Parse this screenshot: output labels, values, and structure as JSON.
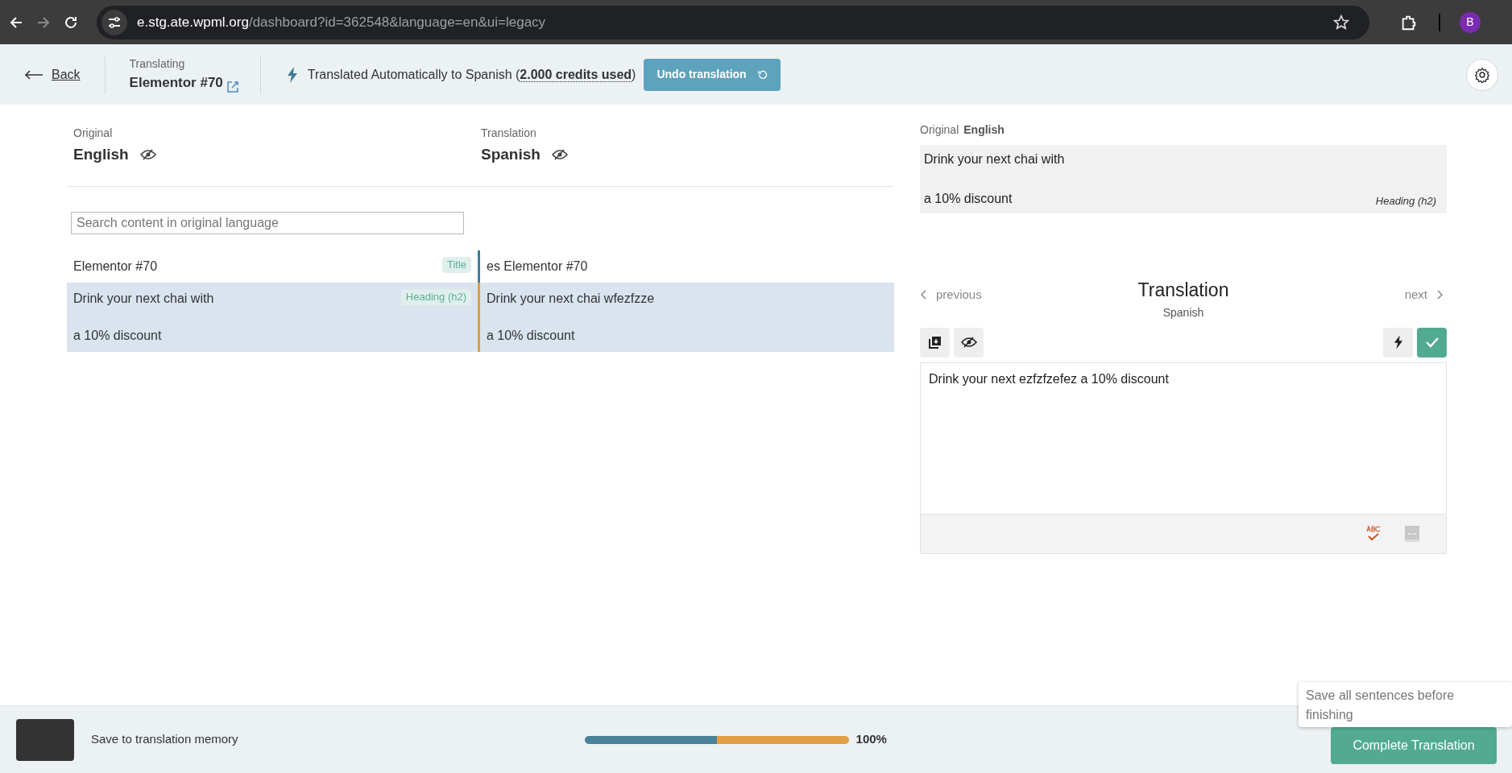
{
  "browser": {
    "url_host": "e.stg.ate.wpml.org",
    "url_path": "/dashboard?id=362548&language=en&ui=legacy",
    "profile_initial": "B"
  },
  "header": {
    "back": "Back",
    "translating_label": "Translating",
    "document": "Elementor #70",
    "status_text": "Translated Automatically to Spanish (",
    "credits": "2.000 credits used",
    "status_close": ")",
    "undo_button": "Undo translation"
  },
  "columns": {
    "original_label": "Original",
    "original_language": "English",
    "translation_label": "Translation",
    "translation_language": "Spanish"
  },
  "search": {
    "placeholder": "Search content in original language"
  },
  "rows": [
    {
      "source": [
        "Elementor #70"
      ],
      "tag": "Title",
      "target": [
        "es Elementor #70"
      ],
      "selected": false,
      "color": "#3f7d95"
    },
    {
      "source": [
        "Drink your next chai with",
        "a 10% discount"
      ],
      "tag": "Heading (h2)",
      "target": [
        "Drink your next chai wfezfzze",
        "a 10% discount"
      ],
      "selected": true,
      "color": "#e29e42"
    }
  ],
  "editor": {
    "original_label": "Original",
    "original_language": "English",
    "original_lines": [
      "Drink your next chai with",
      "a 10% discount"
    ],
    "original_tag": "Heading (h2)",
    "title": "Translation",
    "language": "Spanish",
    "previous": "previous",
    "next": "next",
    "value": "Drink your next ezfzfzefez a 10% discount"
  },
  "footer": {
    "memory_on": true,
    "memory_label": "Save to translation memory",
    "segments": [
      {
        "level": 0.5,
        "color": "#4a8299"
      },
      {
        "level": 0.5,
        "color": "#e29e42"
      }
    ],
    "progress_reading": "100%",
    "complete_button": "Complete Translation",
    "tooltip": "Save all sentences before finishing"
  }
}
